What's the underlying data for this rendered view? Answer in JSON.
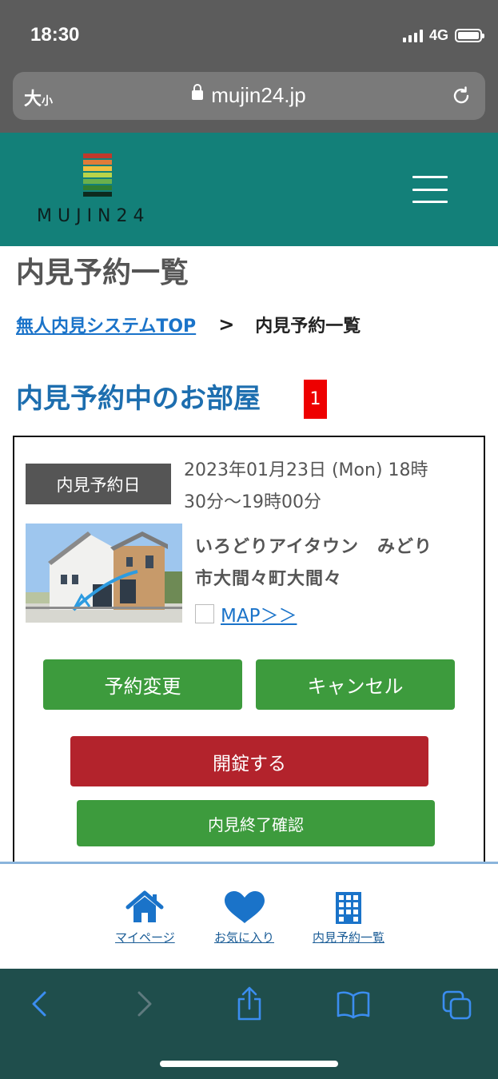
{
  "status_bar": {
    "time": "18:30",
    "network": "4G"
  },
  "browser": {
    "text_size_big": "大",
    "text_size_small": "小",
    "url": "mujin24.jp"
  },
  "header": {
    "logo_text": "MUJIN24",
    "logo_colors": [
      "#c0392b",
      "#e07b39",
      "#f0c040",
      "#b9d44a",
      "#6ab04c",
      "#2e7d32",
      "#0d2a1e"
    ]
  },
  "page": {
    "title": "内見予約一覧",
    "breadcrumb": {
      "link": "無人内見システムTOP",
      "separator": ">",
      "current": "内見予約一覧"
    },
    "section_title": "内見予約中のお部屋",
    "reservation_count": "1"
  },
  "reservation": {
    "date_label": "内見予約日",
    "date_line1": "2023年01月23日 (Mon) 18時",
    "date_line2": "30分～19時00分",
    "property_line1": "いろどりアイタウン　みどり",
    "property_line2": "市大間々町大間々",
    "map_link": "MAP＞＞",
    "change_button": "予約変更",
    "cancel_button": "キャンセル",
    "unlock_button": "開錠する",
    "finish_button": "内見終了確認"
  },
  "bottom_nav": [
    {
      "label": "マイページ",
      "icon": "home-icon"
    },
    {
      "label": "お気に入り",
      "icon": "heart-icon"
    },
    {
      "label": "内見予約一覧",
      "icon": "building-icon"
    }
  ],
  "colors": {
    "brand_teal": "#138079",
    "link_blue": "#1a73c9",
    "badge_red": "#ee0000",
    "button_green": "#3d9b3d",
    "button_red": "#b3232c"
  }
}
